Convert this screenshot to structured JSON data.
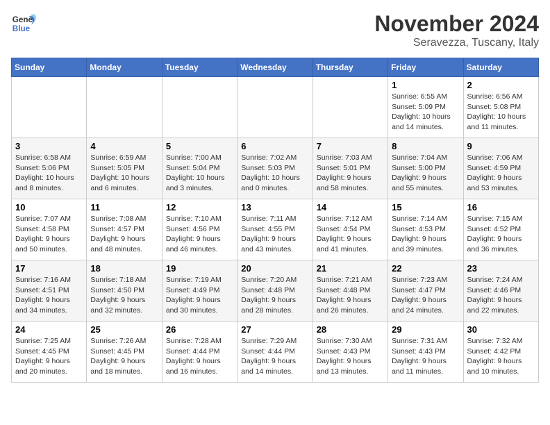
{
  "logo": {
    "line1": "General",
    "line2": "Blue"
  },
  "title": "November 2024",
  "location": "Seravezza, Tuscany, Italy",
  "weekdays": [
    "Sunday",
    "Monday",
    "Tuesday",
    "Wednesday",
    "Thursday",
    "Friday",
    "Saturday"
  ],
  "weeks": [
    [
      {
        "day": "",
        "info": ""
      },
      {
        "day": "",
        "info": ""
      },
      {
        "day": "",
        "info": ""
      },
      {
        "day": "",
        "info": ""
      },
      {
        "day": "",
        "info": ""
      },
      {
        "day": "1",
        "info": "Sunrise: 6:55 AM\nSunset: 5:09 PM\nDaylight: 10 hours\nand 14 minutes."
      },
      {
        "day": "2",
        "info": "Sunrise: 6:56 AM\nSunset: 5:08 PM\nDaylight: 10 hours\nand 11 minutes."
      }
    ],
    [
      {
        "day": "3",
        "info": "Sunrise: 6:58 AM\nSunset: 5:06 PM\nDaylight: 10 hours\nand 8 minutes."
      },
      {
        "day": "4",
        "info": "Sunrise: 6:59 AM\nSunset: 5:05 PM\nDaylight: 10 hours\nand 6 minutes."
      },
      {
        "day": "5",
        "info": "Sunrise: 7:00 AM\nSunset: 5:04 PM\nDaylight: 10 hours\nand 3 minutes."
      },
      {
        "day": "6",
        "info": "Sunrise: 7:02 AM\nSunset: 5:03 PM\nDaylight: 10 hours\nand 0 minutes."
      },
      {
        "day": "7",
        "info": "Sunrise: 7:03 AM\nSunset: 5:01 PM\nDaylight: 9 hours\nand 58 minutes."
      },
      {
        "day": "8",
        "info": "Sunrise: 7:04 AM\nSunset: 5:00 PM\nDaylight: 9 hours\nand 55 minutes."
      },
      {
        "day": "9",
        "info": "Sunrise: 7:06 AM\nSunset: 4:59 PM\nDaylight: 9 hours\nand 53 minutes."
      }
    ],
    [
      {
        "day": "10",
        "info": "Sunrise: 7:07 AM\nSunset: 4:58 PM\nDaylight: 9 hours\nand 50 minutes."
      },
      {
        "day": "11",
        "info": "Sunrise: 7:08 AM\nSunset: 4:57 PM\nDaylight: 9 hours\nand 48 minutes."
      },
      {
        "day": "12",
        "info": "Sunrise: 7:10 AM\nSunset: 4:56 PM\nDaylight: 9 hours\nand 46 minutes."
      },
      {
        "day": "13",
        "info": "Sunrise: 7:11 AM\nSunset: 4:55 PM\nDaylight: 9 hours\nand 43 minutes."
      },
      {
        "day": "14",
        "info": "Sunrise: 7:12 AM\nSunset: 4:54 PM\nDaylight: 9 hours\nand 41 minutes."
      },
      {
        "day": "15",
        "info": "Sunrise: 7:14 AM\nSunset: 4:53 PM\nDaylight: 9 hours\nand 39 minutes."
      },
      {
        "day": "16",
        "info": "Sunrise: 7:15 AM\nSunset: 4:52 PM\nDaylight: 9 hours\nand 36 minutes."
      }
    ],
    [
      {
        "day": "17",
        "info": "Sunrise: 7:16 AM\nSunset: 4:51 PM\nDaylight: 9 hours\nand 34 minutes."
      },
      {
        "day": "18",
        "info": "Sunrise: 7:18 AM\nSunset: 4:50 PM\nDaylight: 9 hours\nand 32 minutes."
      },
      {
        "day": "19",
        "info": "Sunrise: 7:19 AM\nSunset: 4:49 PM\nDaylight: 9 hours\nand 30 minutes."
      },
      {
        "day": "20",
        "info": "Sunrise: 7:20 AM\nSunset: 4:48 PM\nDaylight: 9 hours\nand 28 minutes."
      },
      {
        "day": "21",
        "info": "Sunrise: 7:21 AM\nSunset: 4:48 PM\nDaylight: 9 hours\nand 26 minutes."
      },
      {
        "day": "22",
        "info": "Sunrise: 7:23 AM\nSunset: 4:47 PM\nDaylight: 9 hours\nand 24 minutes."
      },
      {
        "day": "23",
        "info": "Sunrise: 7:24 AM\nSunset: 4:46 PM\nDaylight: 9 hours\nand 22 minutes."
      }
    ],
    [
      {
        "day": "24",
        "info": "Sunrise: 7:25 AM\nSunset: 4:45 PM\nDaylight: 9 hours\nand 20 minutes."
      },
      {
        "day": "25",
        "info": "Sunrise: 7:26 AM\nSunset: 4:45 PM\nDaylight: 9 hours\nand 18 minutes."
      },
      {
        "day": "26",
        "info": "Sunrise: 7:28 AM\nSunset: 4:44 PM\nDaylight: 9 hours\nand 16 minutes."
      },
      {
        "day": "27",
        "info": "Sunrise: 7:29 AM\nSunset: 4:44 PM\nDaylight: 9 hours\nand 14 minutes."
      },
      {
        "day": "28",
        "info": "Sunrise: 7:30 AM\nSunset: 4:43 PM\nDaylight: 9 hours\nand 13 minutes."
      },
      {
        "day": "29",
        "info": "Sunrise: 7:31 AM\nSunset: 4:43 PM\nDaylight: 9 hours\nand 11 minutes."
      },
      {
        "day": "30",
        "info": "Sunrise: 7:32 AM\nSunset: 4:42 PM\nDaylight: 9 hours\nand 10 minutes."
      }
    ]
  ]
}
